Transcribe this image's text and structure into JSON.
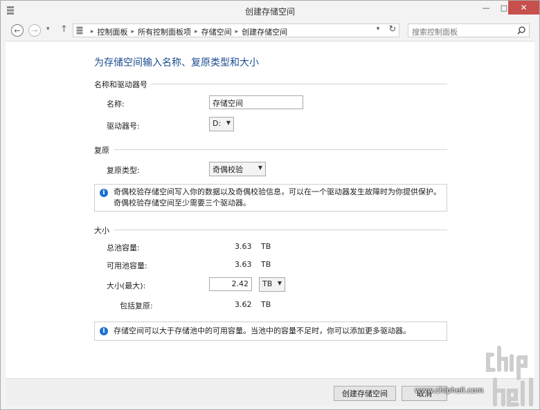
{
  "window": {
    "title": "创建存储空间",
    "minimize_glyph": "—",
    "maximize_glyph": "□",
    "close_glyph": "✕"
  },
  "nav": {
    "back_glyph": "←",
    "forward_glyph": "→",
    "recent_glyph": "▾",
    "up_glyph": "↑",
    "breadcrumbs": [
      "控制面板",
      "所有控制面板项",
      "存储空间",
      "创建存储空间"
    ],
    "dropdown_glyph": "▾",
    "refresh_glyph": "↻"
  },
  "search": {
    "placeholder": "搜索控制面板",
    "icon": "search-icon"
  },
  "main": {
    "heading": "为存储空间输入名称、复原类型和大小",
    "name_section": {
      "label": "名称和驱动器号",
      "name_label": "名称:",
      "name_value": "存储空间",
      "drive_label": "驱动器号:",
      "drive_value": "D:"
    },
    "resiliency_section": {
      "label": "复原",
      "type_label": "复原类型:",
      "type_value": "奇偶校验",
      "info_text": "奇偶校验存储空间写入你的数据以及奇偶校验信息，可以在一个驱动器发生故障时为你提供保护。奇偶校验存储空间至少需要三个驱动器。"
    },
    "size_section": {
      "label": "大小",
      "total_label": "总池容量:",
      "total_value": "3.63",
      "total_unit": "TB",
      "available_label": "可用池容量:",
      "available_value": "3.63",
      "available_unit": "TB",
      "max_label": "大小(最大):",
      "max_value": "2.42",
      "max_unit": "TB",
      "incl_label": "包括复原:",
      "incl_value": "3.62",
      "incl_unit": "TB",
      "info_text": "存储空间可以大于存储池中的可用容量。当池中的容量不足时，你可以添加更多驱动器。",
      "info_glyph": "i"
    }
  },
  "footer": {
    "create_label": "创建存储空间",
    "cancel_label": "取消"
  },
  "watermark": {
    "text": "www.chiphell.com",
    "logo_text": "chip hell"
  },
  "colors": {
    "heading": "#1a4d8f",
    "close_button": "#c7504c",
    "info_icon": "#1f6fd0"
  }
}
